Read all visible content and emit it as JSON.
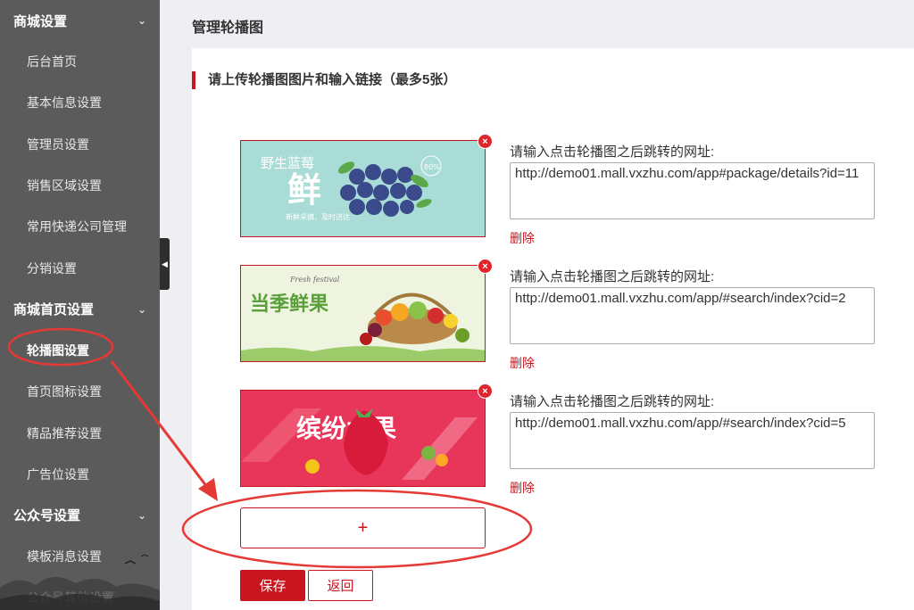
{
  "sidebar": {
    "groups": [
      {
        "label": "商城设置",
        "items": [
          "后台首页",
          "基本信息设置",
          "管理员设置",
          "销售区域设置",
          "常用快递公司管理",
          "分销设置"
        ]
      },
      {
        "label": "商城首页设置",
        "items": [
          "轮播图设置",
          "首页图标设置",
          "精品推荐设置",
          "广告位设置"
        ]
      },
      {
        "label": "公众号设置",
        "items": [
          "模板消息设置",
          "公众号其他设置"
        ]
      }
    ],
    "active_item": "轮播图设置"
  },
  "header": {
    "title": "管理轮播图"
  },
  "main": {
    "section_title": "请上传轮播图图片和输入链接（最多5张）",
    "banners": [
      {
        "image_text": "野生蓝莓",
        "image_big": "鲜",
        "image_sub": "新鲜采摘，及时送达",
        "badge": "80%",
        "url_label": "请输入点击轮播图之后跳转的网址:",
        "url": "http://demo01.mall.vxzhu.com/app#package/details?id=11",
        "delete_label": "删除",
        "close_symbol": "×"
      },
      {
        "image_text": "当季鲜果",
        "image_small": "Fresh festival",
        "url_label": "请输入点击轮播图之后跳转的网址:",
        "url": "http://demo01.mall.vxzhu.com/app/#search/index?cid=2",
        "delete_label": "删除",
        "close_symbol": "×"
      },
      {
        "image_text": "缤纷水果",
        "url_label": "请输入点击轮播图之后跳转的网址:",
        "url": "http://demo01.mall.vxzhu.com/app/#search/index?cid=5",
        "delete_label": "删除",
        "close_symbol": "×"
      }
    ],
    "add_symbol": "+",
    "save_label": "保存",
    "back_label": "返回"
  },
  "colors": {
    "accent": "#c9151e",
    "sidebar_bg": "#5b5b5b",
    "annotation": "#e53935"
  },
  "icons": {
    "group_chevron": "chevron-down-icon",
    "collapse": "caret-left-icon",
    "close": "close-icon",
    "add": "plus-icon"
  }
}
